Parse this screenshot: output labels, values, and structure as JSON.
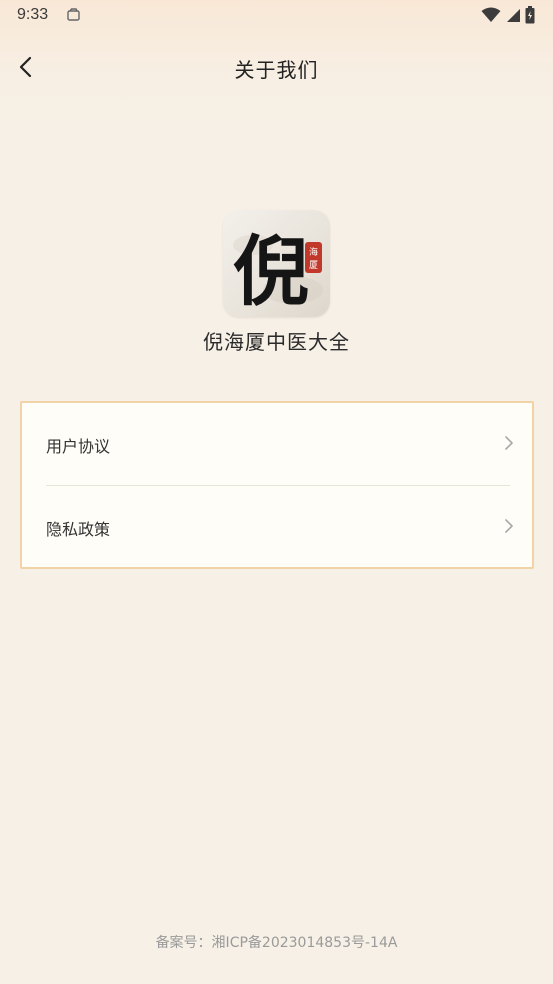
{
  "status_bar": {
    "time": "9:33"
  },
  "header": {
    "title": "关于我们"
  },
  "app": {
    "name": "倪海厦中医大全",
    "logo_char": "倪",
    "seal_text": "海厦"
  },
  "menu": {
    "items": [
      {
        "label": "用户协议"
      },
      {
        "label": "隐私政策"
      }
    ]
  },
  "footer": {
    "icp": "备案号：湘ICP备2023014853号-14A"
  },
  "colors": {
    "background": "#f6f0e6",
    "card_border": "#f1d3a7",
    "seal_red": "#c0392b"
  }
}
